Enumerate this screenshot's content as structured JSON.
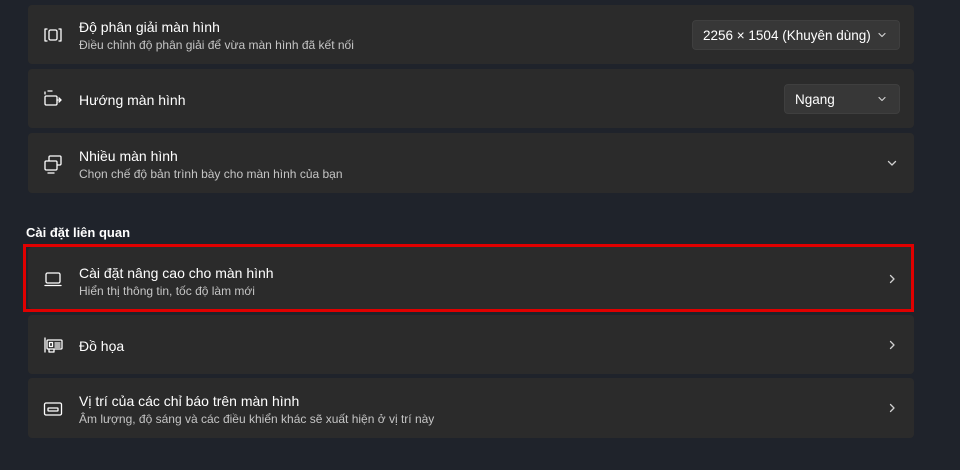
{
  "display_settings": {
    "resolution": {
      "title": "Độ phân giải màn hình",
      "description": "Điều chỉnh độ phân giải để vừa màn hình đã kết nối",
      "value": "2256 × 1504 (Khuyên dùng)",
      "icon": "resolution-icon"
    },
    "orientation": {
      "title": "Hướng màn hình",
      "value": "Ngang",
      "icon": "orientation-icon"
    },
    "multiple_displays": {
      "title": "Nhiều màn hình",
      "description": "Chọn chế độ bản trình bày cho màn hình của bạn",
      "icon": "multiple-displays-icon"
    }
  },
  "related_settings": {
    "header": "Cài đặt liên quan",
    "items": [
      {
        "title": "Cài đặt nâng cao cho màn hình",
        "description": "Hiển thị thông tin, tốc độ làm mới",
        "icon": "monitor-icon",
        "highlighted": true
      },
      {
        "title": "Đồ họa",
        "icon": "graphics-card-icon"
      },
      {
        "title": "Vị trí của các chỉ báo trên màn hình",
        "description": "Âm lượng, độ sáng và các điều khiển khác sẽ xuất hiện ở vị trí này",
        "icon": "screen-indicator-icon"
      }
    ]
  },
  "colors": {
    "background": "#1f232b",
    "card": "#2b2b2b",
    "highlight_border": "#e00000"
  }
}
